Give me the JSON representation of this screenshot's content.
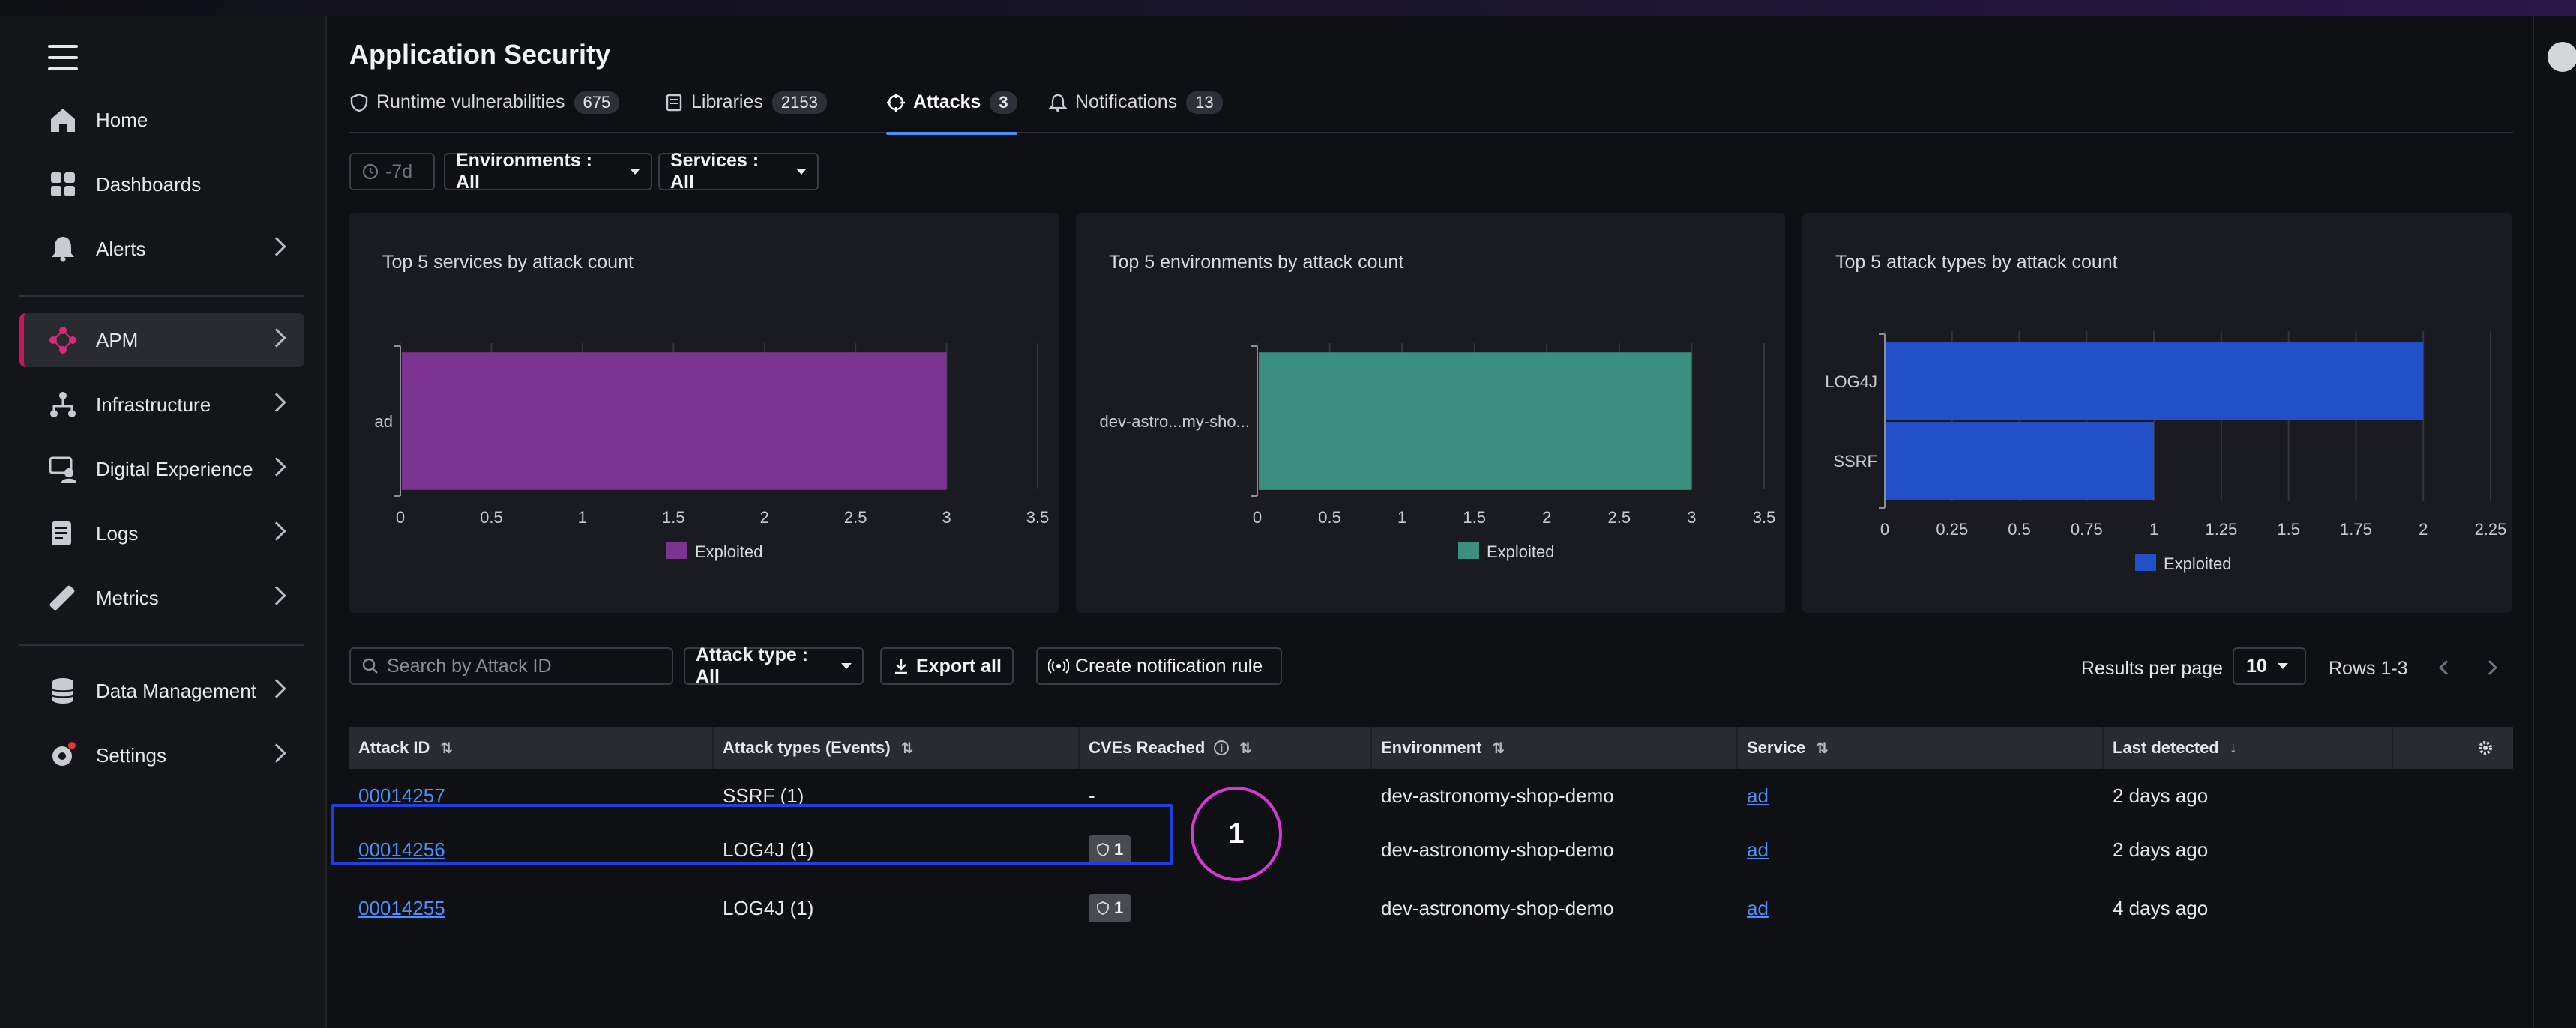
{
  "app": {
    "title": "Application Security"
  },
  "sidebar": {
    "items": [
      {
        "label": "Home",
        "icon": "home-icon",
        "chevron": false
      },
      {
        "label": "Dashboards",
        "icon": "dashboard-icon",
        "chevron": false
      },
      {
        "label": "Alerts",
        "icon": "bell-icon",
        "chevron": true
      },
      {
        "label": "APM",
        "icon": "apm-icon",
        "chevron": true,
        "active": true
      },
      {
        "label": "Infrastructure",
        "icon": "infrastructure-icon",
        "chevron": true
      },
      {
        "label": "Digital Experience",
        "icon": "digital-experience-icon",
        "chevron": true
      },
      {
        "label": "Logs",
        "icon": "logs-icon",
        "chevron": true
      },
      {
        "label": "Metrics",
        "icon": "metrics-icon",
        "chevron": true
      },
      {
        "label": "Data Management",
        "icon": "data-management-icon",
        "chevron": true
      },
      {
        "label": "Settings",
        "icon": "settings-icon",
        "chevron": true
      }
    ]
  },
  "tabs": [
    {
      "label": "Runtime vulnerabilities",
      "count": "675",
      "icon": "shield-icon"
    },
    {
      "label": "Libraries",
      "count": "2153",
      "icon": "book-icon"
    },
    {
      "label": "Attacks",
      "count": "3",
      "icon": "target-icon",
      "active": true
    },
    {
      "label": "Notifications",
      "count": "13",
      "icon": "bell-icon"
    }
  ],
  "filters": {
    "time": "-7d",
    "environments": "Environments : All",
    "services": "Services : All"
  },
  "charts_text": {
    "legend": "Exploited"
  },
  "chart_data": [
    {
      "type": "bar",
      "orientation": "horizontal",
      "title": "Top 5 services by attack count",
      "categories": [
        "ad"
      ],
      "series": [
        {
          "name": "Exploited",
          "values": [
            3
          ]
        }
      ],
      "xlim": [
        0,
        3.5
      ],
      "xticks": [
        "0",
        "0.5",
        "1",
        "1.5",
        "2",
        "2.5",
        "3",
        "3.5"
      ],
      "color": "#7b3590",
      "grid": true,
      "legend": "bottom"
    },
    {
      "type": "bar",
      "orientation": "horizontal",
      "title": "Top 5 environments by attack count",
      "categories": [
        "dev-astro...my-sho..."
      ],
      "series": [
        {
          "name": "Exploited",
          "values": [
            3
          ]
        }
      ],
      "xlim": [
        0,
        3.5
      ],
      "xticks": [
        "0",
        "0.5",
        "1",
        "1.5",
        "2",
        "2.5",
        "3",
        "3.5"
      ],
      "color": "#3a8f80",
      "grid": true,
      "legend": "bottom"
    },
    {
      "type": "bar",
      "orientation": "horizontal",
      "title": "Top 5 attack types by attack count",
      "categories": [
        "LOG4J",
        "SSRF"
      ],
      "series": [
        {
          "name": "Exploited",
          "values": [
            2,
            1
          ]
        }
      ],
      "xlim": [
        0,
        2.25
      ],
      "xticks": [
        "0",
        "0.25",
        "0.5",
        "0.75",
        "1",
        "1.25",
        "1.5",
        "1.75",
        "2",
        "2.25"
      ],
      "color": "#2150c8",
      "grid": true,
      "legend": "bottom"
    }
  ],
  "toolbar": {
    "search_placeholder": "Search by Attack ID",
    "attack_type": "Attack type : All",
    "export": "Export all",
    "create_rule": "Create notification rule",
    "rpp_label": "Results per page",
    "rpp_value": "10",
    "rows": "Rows 1-3"
  },
  "table": {
    "columns": [
      "Attack ID",
      "Attack types (Events)",
      "CVEs Reached",
      "Environment",
      "Service",
      "Last detected"
    ],
    "rows": [
      {
        "id": "00014257",
        "types": "SSRF (1)",
        "cves": "-",
        "env": "dev-astronomy-shop-demo",
        "service": "ad",
        "last": "2 days ago"
      },
      {
        "id": "00014256",
        "types": "LOG4J (1)",
        "cves": "1",
        "env": "dev-astronomy-shop-demo",
        "service": "ad",
        "last": "2 days ago"
      },
      {
        "id": "00014255",
        "types": "LOG4J (1)",
        "cves": "1",
        "env": "dev-astronomy-shop-demo",
        "service": "ad",
        "last": "4 days ago"
      }
    ]
  },
  "annotation": {
    "marker": "1"
  }
}
